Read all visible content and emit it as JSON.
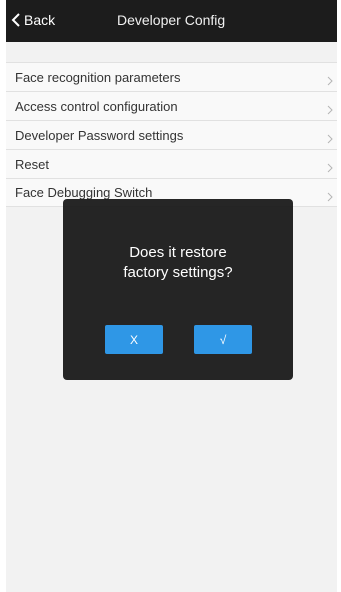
{
  "header": {
    "back_label": "Back",
    "title": "Developer Config"
  },
  "menu": {
    "items": [
      {
        "label": "Face recognition parameters"
      },
      {
        "label": "Access control configuration"
      },
      {
        "label": "Developer Password settings"
      },
      {
        "label": "Reset"
      },
      {
        "label": "Face Debugging Switch"
      }
    ]
  },
  "dialog": {
    "message_line1": "Does it  restore",
    "message_line2": "factory settings?",
    "cancel_label": "X",
    "confirm_label": "√"
  },
  "colors": {
    "header_bg": "#1c1c1c",
    "accent_button": "#2f97e6",
    "dialog_bg": "#141414"
  }
}
